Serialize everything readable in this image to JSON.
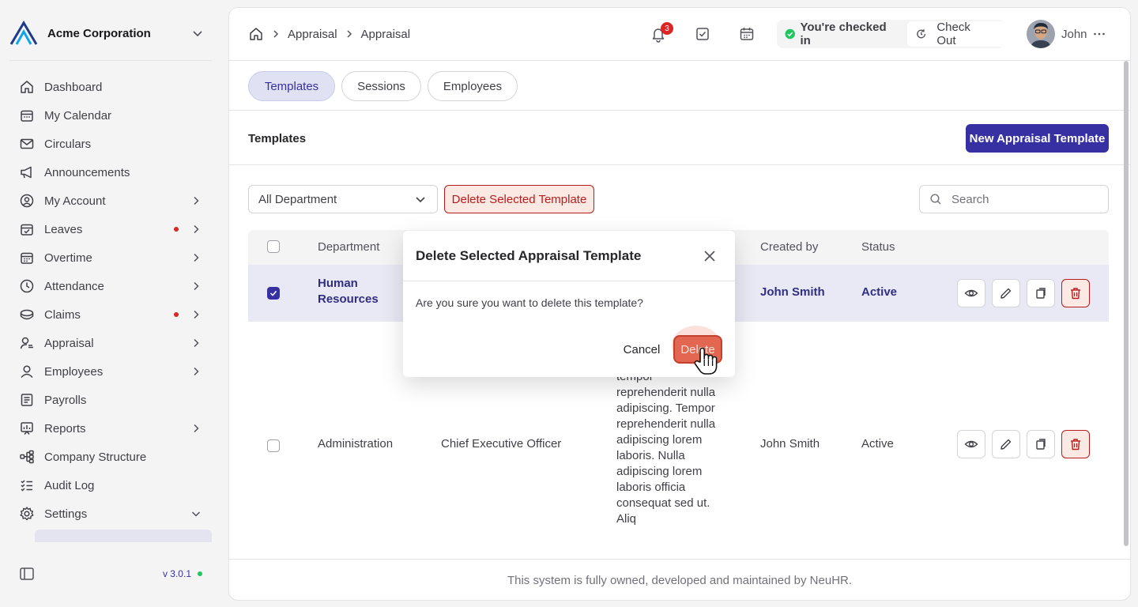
{
  "sidebar": {
    "company": "Acme Corporation",
    "items": [
      {
        "label": "Dashboard",
        "icon": "home-icon",
        "dot": false,
        "arrow": false
      },
      {
        "label": "My Calendar",
        "icon": "calendar-icon",
        "dot": false,
        "arrow": false
      },
      {
        "label": "Circulars",
        "icon": "mail-icon",
        "dot": false,
        "arrow": false
      },
      {
        "label": "Announcements",
        "icon": "megaphone-icon",
        "dot": false,
        "arrow": false
      },
      {
        "label": "My Account",
        "icon": "user-circle-icon",
        "dot": false,
        "arrow": true
      },
      {
        "label": "Leaves",
        "icon": "calendar-check-icon",
        "dot": true,
        "arrow": true
      },
      {
        "label": "Overtime",
        "icon": "calendar-grid-icon",
        "dot": false,
        "arrow": true
      },
      {
        "label": "Attendance",
        "icon": "clock-icon",
        "dot": false,
        "arrow": true
      },
      {
        "label": "Claims",
        "icon": "coins-icon",
        "dot": true,
        "arrow": true
      },
      {
        "label": "Appraisal",
        "icon": "user-search-icon",
        "dot": false,
        "arrow": true
      },
      {
        "label": "Employees",
        "icon": "user-icon",
        "dot": false,
        "arrow": true
      },
      {
        "label": "Payrolls",
        "icon": "receipt-icon",
        "dot": false,
        "arrow": false
      },
      {
        "label": "Reports",
        "icon": "chart-icon",
        "dot": false,
        "arrow": true
      },
      {
        "label": "Company Structure",
        "icon": "hierarchy-icon",
        "dot": false,
        "arrow": false
      },
      {
        "label": "Audit Log",
        "icon": "list-check-icon",
        "dot": false,
        "arrow": false
      },
      {
        "label": "Settings",
        "icon": "gear-icon",
        "dot": false,
        "arrow": "down"
      }
    ],
    "version": "v 3.0.1"
  },
  "topbar": {
    "breadcrumb": [
      "Appraisal",
      "Appraisal"
    ],
    "notification_count": "3",
    "checkin_status": "You're checked in",
    "checkout_label": "Check Out",
    "user_name": "John"
  },
  "tabs": [
    {
      "label": "Templates",
      "active": true
    },
    {
      "label": "Sessions",
      "active": false
    },
    {
      "label": "Employees",
      "active": false
    }
  ],
  "section": {
    "title": "Templates",
    "new_button": "New Appraisal Template"
  },
  "filters": {
    "department": "All Department",
    "delete_selected": "Delete Selected Template",
    "search_placeholder": "Search"
  },
  "table": {
    "headers": {
      "department": "Department",
      "created_by": "Created by",
      "status": "Status"
    },
    "rows": [
      {
        "department": "Human Resources",
        "created_by": "John Smith",
        "status": "Active",
        "selected": true
      },
      {
        "department": "Administration",
        "designation": "Chief Executive Officer",
        "description_lines": [
          "tempor",
          "reprehenderit nulla",
          "adipiscing. Tempor",
          "reprehenderit nulla",
          "adipiscing lorem",
          "laboris. Nulla",
          "adipiscing lorem",
          "laboris officia",
          "consequat sed ut.",
          "Aliq"
        ],
        "created_by": "John Smith",
        "status": "Active",
        "selected": false
      }
    ]
  },
  "footer": "This system is fully owned, developed and maintained by NeuHR.",
  "modal": {
    "title": "Delete Selected Appraisal Template",
    "body": "Are you sure you want to delete this template?",
    "cancel": "Cancel",
    "confirm": "Delete"
  },
  "colors": {
    "accent": "#3730a3",
    "danger": "#b91c1c",
    "success": "#22c55e"
  }
}
